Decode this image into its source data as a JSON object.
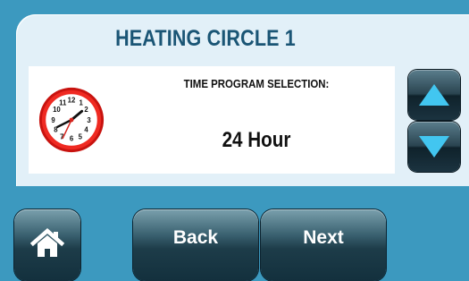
{
  "header": {
    "title": "HEATING CIRCLE 1"
  },
  "setting": {
    "label": "TIME PROGRAM SELECTION:",
    "value": "24 Hour",
    "icon": "clock-icon"
  },
  "controls": {
    "up_icon": "arrow-up-icon",
    "down_icon": "arrow-down-icon"
  },
  "footer": {
    "home_icon": "home-icon",
    "back_label": "Back",
    "next_label": "Next"
  },
  "colors": {
    "background": "#3c99bf",
    "panel": "#e2f0f8",
    "title": "#1a5575",
    "arrow": "#42c6f0",
    "clock_rim": "#e2201b"
  }
}
